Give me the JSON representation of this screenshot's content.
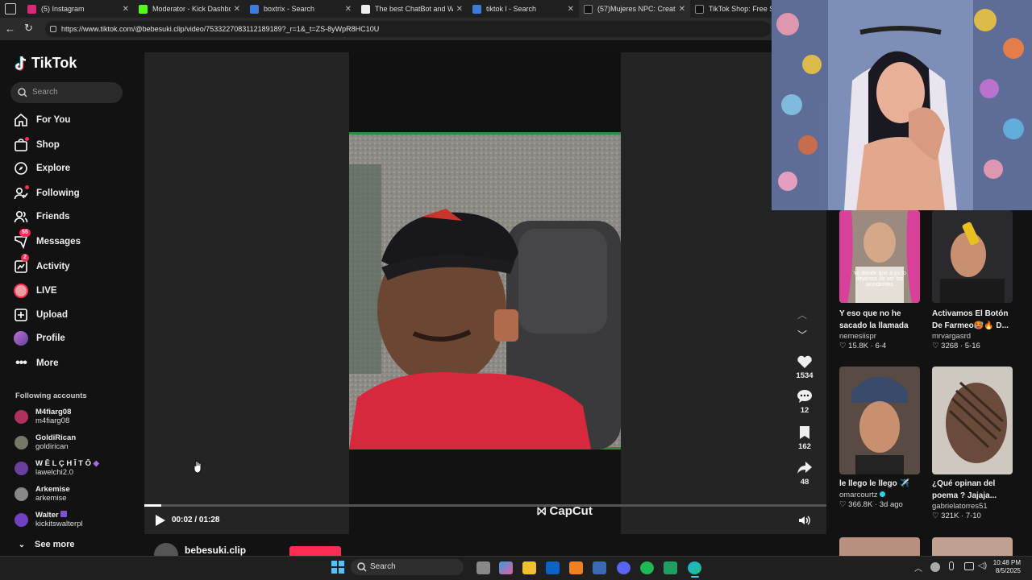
{
  "tabs": [
    {
      "title": "(5) Instagram",
      "color": "#d62976"
    },
    {
      "title": "Moderator - Kick Dashboard",
      "color": "#53fc18"
    },
    {
      "title": "boxtrix - Search",
      "color": "#3b7ddd"
    },
    {
      "title": "The best ChatBot and Widgets",
      "color": "#eeeeee"
    },
    {
      "title": "tiktok l - Search",
      "color": "#3b7ddd"
    },
    {
      "title": "(57)Mujeres NPC: Creatividad",
      "color": "#111111"
    },
    {
      "title": "TikTok Shop: Free Shipping",
      "color": "#111111"
    }
  ],
  "address_bar": {
    "url": "https://www.tiktok.com/@bebesuki.clip/video/7533227083112189189?_r=1&_t=ZS-8yWpR8HC10U"
  },
  "sidebar": {
    "logo": "TikTok",
    "search_placeholder": "Search",
    "nav": [
      {
        "label": "For You",
        "icon": "home-icon"
      },
      {
        "label": "Shop",
        "icon": "shop-icon"
      },
      {
        "label": "Explore",
        "icon": "compass-icon"
      },
      {
        "label": "Following",
        "icon": "following-icon"
      },
      {
        "label": "Friends",
        "icon": "friends-icon"
      },
      {
        "label": "Messages",
        "icon": "messages-icon",
        "badge": "55"
      },
      {
        "label": "Activity",
        "icon": "activity-icon",
        "badge": "2"
      },
      {
        "label": "LIVE",
        "icon": "live-icon"
      },
      {
        "label": "Upload",
        "icon": "upload-icon"
      },
      {
        "label": "Profile",
        "icon": "profile-icon"
      },
      {
        "label": "More",
        "icon": "more-icon"
      }
    ],
    "following_header": "Following accounts",
    "accounts": [
      {
        "name": "M4fiarg08",
        "handle": "m4fiarg08",
        "color": "#b03060"
      },
      {
        "name": "GoldiRican",
        "handle": "goldirican",
        "color": "#777766"
      },
      {
        "name": "W Ē L Ç H Ī T Ō",
        "handle": "lawelchi2.0",
        "color": "#6a3fa0"
      },
      {
        "name": "Arkemise",
        "handle": "arkemise",
        "color": "#888888"
      },
      {
        "name": "Walter",
        "handle": "kickitswalterpl",
        "color": "#7040c0"
      }
    ],
    "see_more": "See more"
  },
  "player": {
    "current_time": "00:02",
    "duration": "01:28",
    "time_text": "00:02 / 01:28",
    "progress": 0.025,
    "watermark": "CapCut",
    "next_author": "bebesuki.clip"
  },
  "actions": {
    "likes": "1534",
    "comments": "12",
    "saves": "162",
    "shares": "48"
  },
  "recommendations": [
    {
      "title": "Y eso que no he sacado la llamada a...",
      "author": "nemesiispr",
      "likes": "15.8K",
      "date": "6-4",
      "overlay": "Yo donde que a yo lo dejamos de ser los accidentes"
    },
    {
      "title": "Activamos El Botón De Farmeo🥵🔥 D...",
      "author": "mrvargasrd",
      "likes": "3268",
      "date": "5-16"
    },
    {
      "title": "le llego le llego ✈️",
      "author": "omarcourtz",
      "likes": "366.8K",
      "date": "3d ago"
    },
    {
      "title": "¿Qué opinan del poema ? Jajaja...",
      "author": "gabrielatorres51",
      "likes": "321K",
      "date": "7-10"
    }
  ],
  "taskbar": {
    "search_placeholder": "Search",
    "time": "10:48 PM",
    "date": "8/5/2025"
  }
}
